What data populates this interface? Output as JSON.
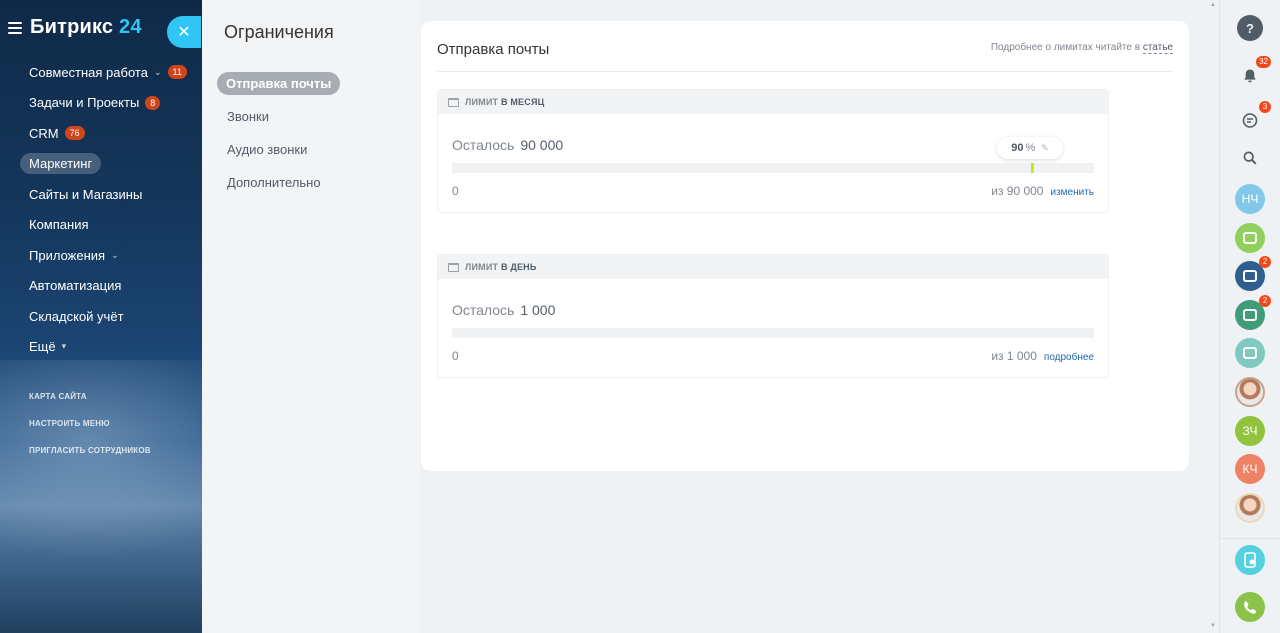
{
  "logo": {
    "name": "Битрикс",
    "num": "24"
  },
  "menu": [
    {
      "label": "Совместная работа",
      "chevron": true,
      "badge": "11"
    },
    {
      "label": "Задачи и Проекты",
      "badge": "8"
    },
    {
      "label": "CRM",
      "badge": "76"
    },
    {
      "label": "Маркетинг",
      "active": true
    },
    {
      "label": "Сайты и Магазины"
    },
    {
      "label": "Компания"
    },
    {
      "label": "Приложения",
      "chevron": true
    },
    {
      "label": "Автоматизация"
    },
    {
      "label": "Складской учёт"
    },
    {
      "label": "Ещё",
      "chevron_small": true
    }
  ],
  "submenu": [
    "КАРТА САЙТА",
    "НАСТРОИТЬ МЕНЮ",
    "ПРИГЛАСИТЬ СОТРУДНИКОВ"
  ],
  "subnav": {
    "title": "Ограничения",
    "items": [
      "Отправка почты",
      "Звонки",
      "Аудио звонки",
      "Дополнительно"
    ]
  },
  "card": {
    "title": "Отправка почты",
    "hint_prefix": "Подробнее о лимитах читайте в",
    "hint_link": "статье"
  },
  "month": {
    "head_prefix": "ЛИМИТ",
    "head_strong": "В МЕСЯЦ",
    "remain_label": "Осталось",
    "remain_value": "90 000",
    "percent": "90",
    "percent_unit": "%",
    "fill_fraction": 0.9,
    "zero": "0",
    "of_total": "из 90 000",
    "link": "изменить"
  },
  "day": {
    "head_prefix": "ЛИМИТ",
    "head_strong": "В ДЕНЬ",
    "remain_label": "Осталось",
    "remain_value": "1 000",
    "zero": "0",
    "of_total": "из 1 000",
    "link": "подробнее"
  },
  "rightbar": {
    "help": "?",
    "notifications_badge": "32",
    "chat_badge": "3",
    "users": [
      {
        "initials": "НЧ",
        "color": "#82c8e8"
      },
      {
        "initials": "",
        "color": "#8fd15c",
        "icon": "check-icon"
      },
      {
        "initials": "",
        "color": "#2f5f8f",
        "icon": "group-chat-icon",
        "badge": "2"
      },
      {
        "initials": "",
        "color": "#3f9e79",
        "icon": "open-line-icon",
        "badge": "2"
      },
      {
        "initials": "",
        "color": "#7fc9c1",
        "icon": "group-icon"
      },
      {
        "initials": "",
        "color": "#c8a28c",
        "icon": "avatar-photo"
      },
      {
        "initials": "ЗЧ",
        "color": "#92c33d"
      },
      {
        "initials": "КЧ",
        "color": "#ef8264"
      },
      {
        "initials": "",
        "color": "#e8dcb8",
        "icon": "avatar-photo"
      }
    ]
  }
}
